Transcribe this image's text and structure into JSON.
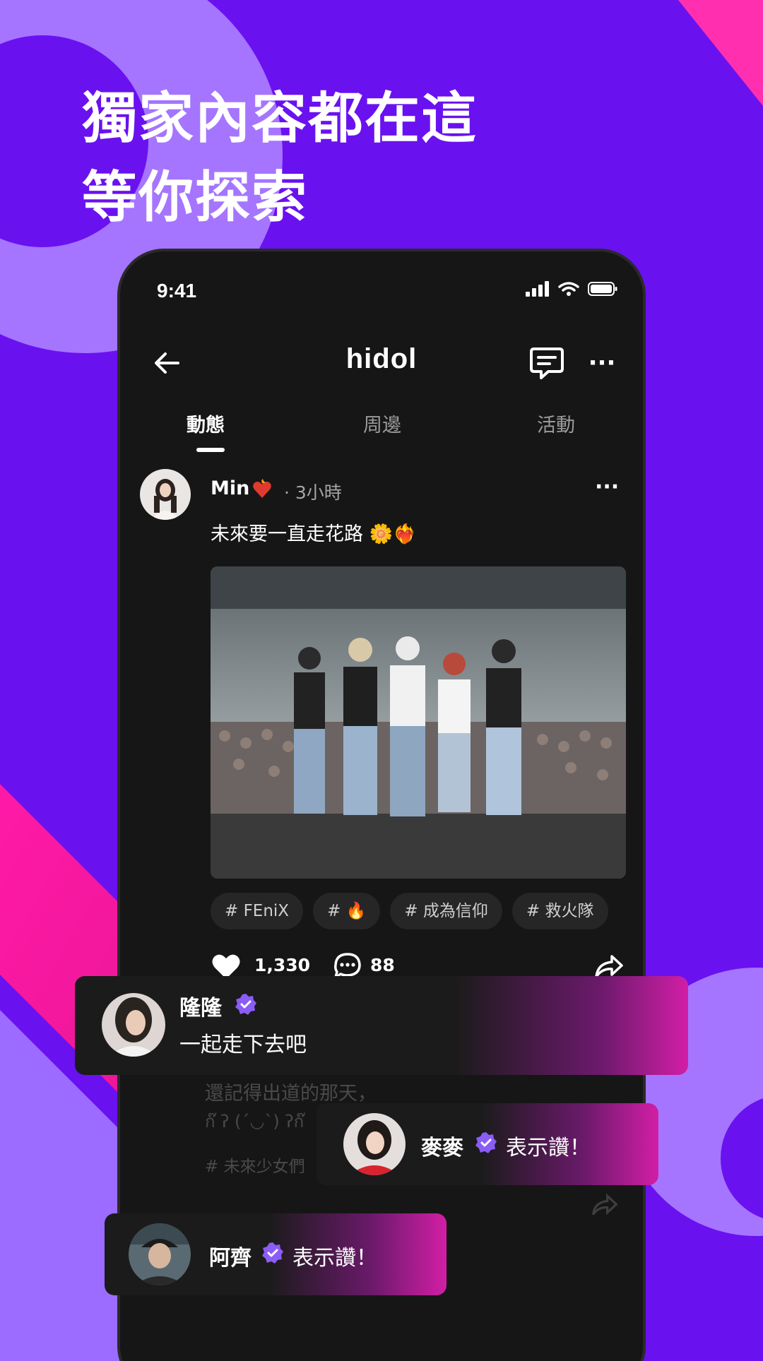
{
  "headline": [
    "獨家內容都在這",
    "等你探索"
  ],
  "status_bar": {
    "time": "9:41"
  },
  "navbar": {
    "brand": "hidol"
  },
  "tabs": [
    {
      "label": "動態",
      "active": true
    },
    {
      "label": "周邊",
      "active": false
    },
    {
      "label": "活動",
      "active": false
    }
  ],
  "post": {
    "author": "Min",
    "time_ago": "· 3小時",
    "caption": "未來要一直走花路 🌼❤️‍🔥",
    "tags": [
      "# FEniX",
      "# 🔥",
      "# 成為信仰",
      "# 救火隊"
    ],
    "like_count": "1,330",
    "comment_count": "88"
  },
  "background_post": {
    "caption": "還記得出道的那天，",
    "line2": "ก๊ ʔ (ˊ◡ˋ) ʔก๊",
    "tag": "# 未來少女們"
  },
  "overlays": [
    {
      "name": "隆隆",
      "text": "一起走下去吧"
    },
    {
      "name": "麥麥",
      "text": "表示讚！"
    },
    {
      "name": "阿齊",
      "text": "表示讚！"
    }
  ],
  "colors": {
    "background": "#6a11f0",
    "accent_pink": "#ff1aa6",
    "accent_lavender": "#9b6cff",
    "verified": "#8b5cf6",
    "phone_body": "#161616"
  }
}
